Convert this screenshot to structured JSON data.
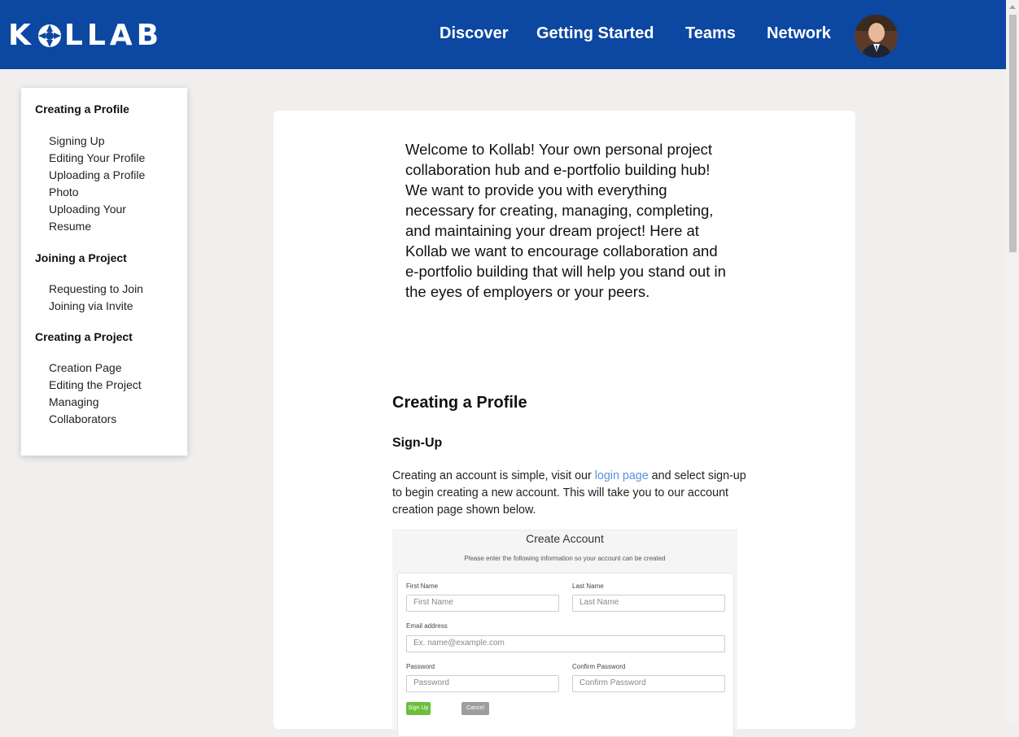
{
  "header": {
    "logo": "KOLLAB",
    "nav": [
      "Discover",
      "Getting Started",
      "Teams",
      "Network"
    ],
    "avatar_alt": "User avatar",
    "bg_color": "#0c47a1"
  },
  "sidebar": {
    "sections": [
      {
        "title": "Creating a Profile",
        "items": [
          "Signing Up",
          "Editing Your Profile",
          "Uploading a Profile Photo",
          "Uploading Your Resume"
        ]
      },
      {
        "title": "Joining a Project",
        "items": [
          "Requesting to Join",
          "Joining via Invite"
        ]
      },
      {
        "title": "Creating a Project",
        "items": [
          "Creation Page",
          "Editing the Project",
          "Managing Collaborators"
        ]
      }
    ]
  },
  "main": {
    "intro": "Welcome to Kollab! Your own personal project collaboration hub and e-portfolio building hub! We want to provide you with everything necessary for creating, managing, completing, and maintaining your dream project! Here at Kollab we want to encourage collaboration and e-portfolio building that will help you stand out in the eyes of employers or your peers.",
    "section_title": "Creating a Profile",
    "subsection_title": "Sign-Up",
    "para_before": "Creating an account is simple, visit our ",
    "para_link": "login page",
    "para_after": " and select sign-up to begin creating a new account. This will take you to our account creation page shown below."
  },
  "form": {
    "title": "Create Account",
    "subtitle": "Please enter the following information so your account can be created",
    "first_name_label": "First Name",
    "first_name_placeholder": "First Name",
    "last_name_label": "Last Name",
    "last_name_placeholder": "Last Name",
    "email_label": "Email address",
    "email_placeholder": "Ex. name@example.com",
    "password_label": "Password",
    "password_placeholder": "Password",
    "confirm_label": "Confirm Password",
    "confirm_placeholder": "Confirm Password",
    "signup_button": "Sign Up",
    "cancel_button": "Cancel",
    "signup_color": "#6bbf3a",
    "cancel_color": "#9e9e9e"
  }
}
